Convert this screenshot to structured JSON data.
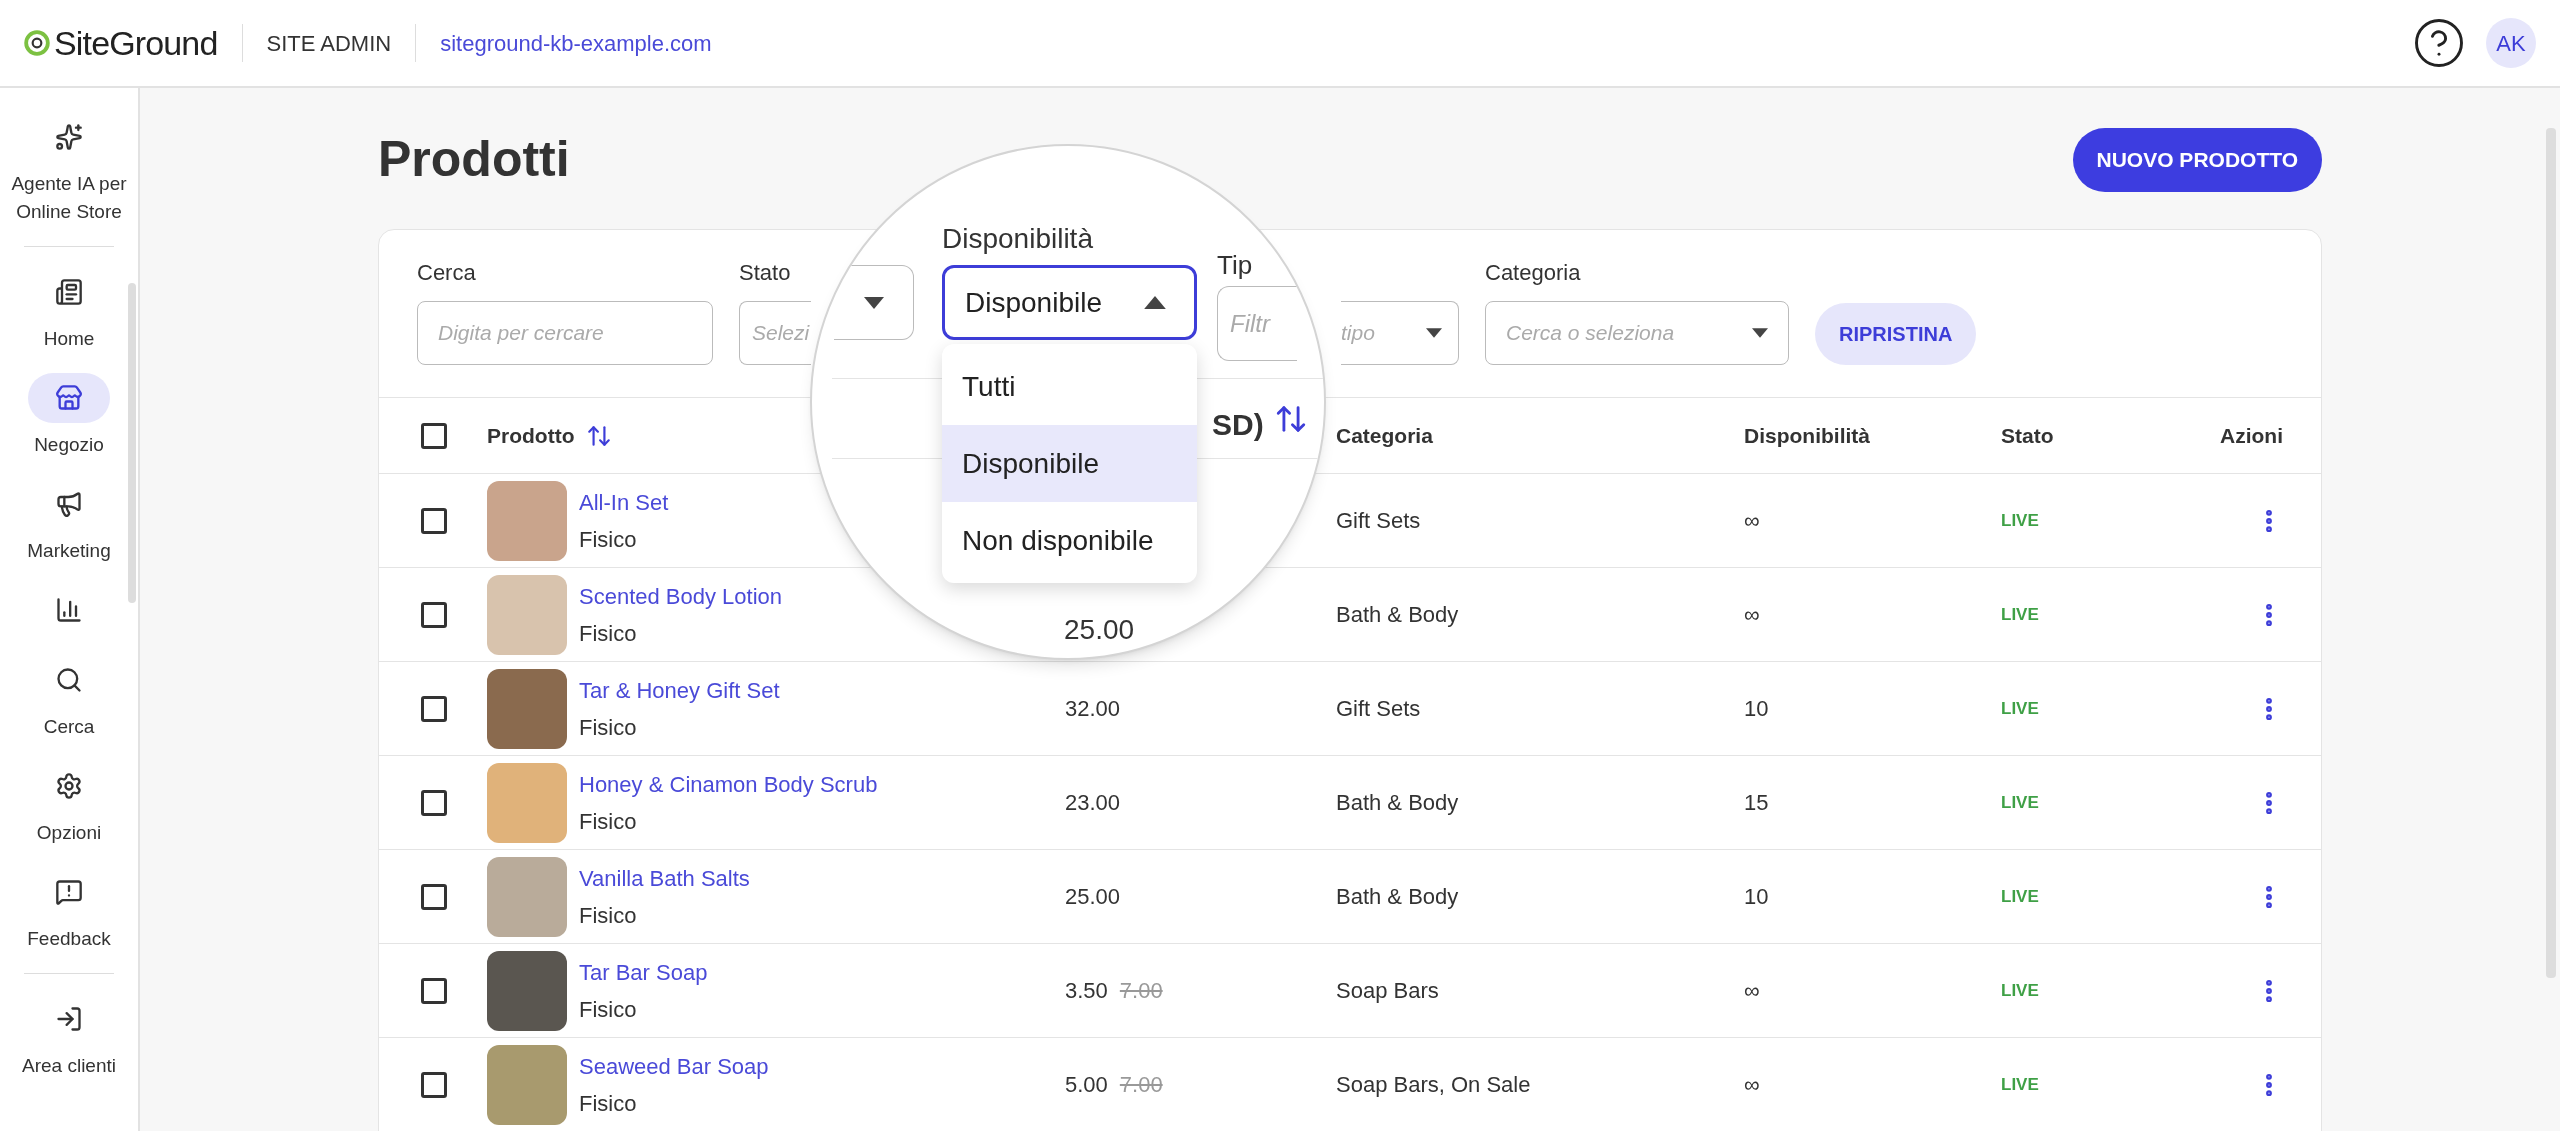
{
  "header": {
    "logo_text": "SiteGround",
    "section": "SITE ADMIN",
    "site": "siteground-kb-example.com",
    "avatar": "AK"
  },
  "sidebar": {
    "items": [
      {
        "label": "Agente IA per Online Store",
        "selected": false
      },
      {
        "label": "Home",
        "selected": false
      },
      {
        "label": "Negozio",
        "selected": true
      },
      {
        "label": "Marketing",
        "selected": false
      },
      {
        "selected": false
      },
      {
        "label": "Cerca",
        "selected": false
      },
      {
        "label": "Opzioni",
        "selected": false
      },
      {
        "label": "Feedback",
        "selected": false
      },
      {
        "label": "Area clienti",
        "selected": false
      }
    ]
  },
  "page": {
    "title": "Prodotti",
    "new_button": "NUOVO PRODOTTO"
  },
  "filters": {
    "search": {
      "label": "Cerca",
      "placeholder": "Digita per cercare"
    },
    "status": {
      "label": "Stato",
      "placeholder": "Selezi"
    },
    "type": {
      "label": "Tip",
      "placeholder_parts": [
        "Filtr",
        "tipo"
      ]
    },
    "category": {
      "label": "Categoria",
      "placeholder": "Cerca o seleziona"
    },
    "reset_button": "RIPRISTINA"
  },
  "magnifier": {
    "label": "Disponibilità",
    "value": "Disponibile",
    "expanded": true,
    "options": [
      {
        "label": "Tutti",
        "selected": false
      },
      {
        "label": "Disponibile",
        "selected": true
      },
      {
        "label": "Non disponibile",
        "selected": false
      }
    ],
    "header_fragment": "SD)",
    "price_fragment": "25.00"
  },
  "table": {
    "header_checked": false,
    "columns": [
      "Prodotto",
      "Categoria",
      "Disponibilità",
      "Stato",
      "Azioni"
    ],
    "rows": [
      {
        "name": "All-In Set",
        "type": "Fisico",
        "category": "Gift Sets",
        "availability": "∞",
        "status": "LIVE",
        "checked": false
      },
      {
        "name": "Scented Body Lotion",
        "type": "Fisico",
        "category": "Bath & Body",
        "availability": "∞",
        "status": "LIVE",
        "checked": false
      },
      {
        "name": "Tar & Honey Gift Set",
        "type": "Fisico",
        "price": "32.00",
        "category": "Gift Sets",
        "availability": "10",
        "status": "LIVE",
        "checked": false
      },
      {
        "name": "Honey & Cinamon Body Scrub",
        "type": "Fisico",
        "price": "23.00",
        "category": "Bath & Body",
        "availability": "15",
        "status": "LIVE",
        "checked": false
      },
      {
        "name": "Vanilla Bath Salts",
        "type": "Fisico",
        "price": "25.00",
        "category": "Bath & Body",
        "availability": "10",
        "status": "LIVE",
        "checked": false
      },
      {
        "name": "Tar Bar Soap",
        "type": "Fisico",
        "price": "3.50",
        "old_price": "7.00",
        "category": "Soap Bars",
        "availability": "∞",
        "status": "LIVE",
        "checked": false
      },
      {
        "name": "Seaweed Bar Soap",
        "type": "Fisico",
        "price": "5.00",
        "old_price": "7.00",
        "category": "Soap Bars, On Sale",
        "availability": "∞",
        "status": "LIVE",
        "checked": false
      }
    ]
  }
}
